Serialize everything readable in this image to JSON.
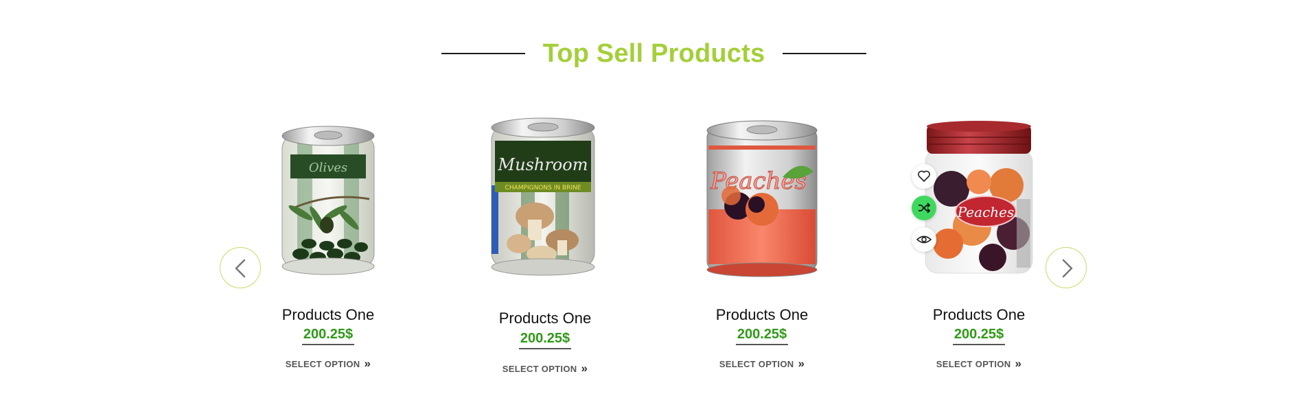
{
  "section": {
    "title": "Top Sell Products"
  },
  "products": [
    {
      "name": "Products One",
      "price": "200.25$",
      "action": "SELECT OPTION",
      "label": "Olives"
    },
    {
      "name": "Products One",
      "price": "200.25$",
      "action": "SELECT OPTION",
      "label": "Mushroom",
      "sublabel": "CHAMPIGNONS IN BRINE"
    },
    {
      "name": "Products One",
      "price": "200.25$",
      "action": "SELECT OPTION",
      "label": "Peaches"
    },
    {
      "name": "Products One",
      "price": "200.25$",
      "action": "SELECT OPTION",
      "label": "Peaches"
    }
  ],
  "colors": {
    "accent": "#a4cf3a",
    "price": "#2f9a17",
    "compare_active": "#3fd85f"
  },
  "icons": {
    "prev": "chevron-left-icon",
    "next": "chevron-right-icon",
    "wishlist": "heart-icon",
    "compare": "shuffle-icon",
    "quickview": "eye-icon"
  }
}
